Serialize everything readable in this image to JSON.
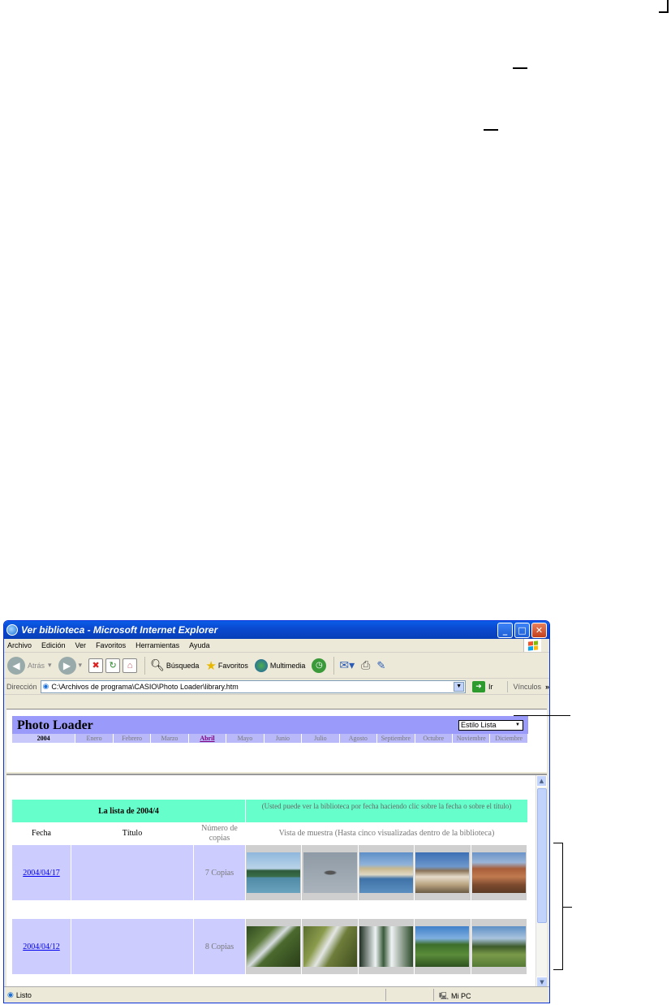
{
  "window": {
    "title": "Ver biblioteca - Microsoft Internet Explorer"
  },
  "menu": [
    "Archivo",
    "Edición",
    "Ver",
    "Favoritos",
    "Herramientas",
    "Ayuda"
  ],
  "toolbar": {
    "back": "Atrás",
    "search": "Búsqueda",
    "favorites": "Favoritos",
    "media": "Multimedia"
  },
  "address": {
    "label": "Dirección",
    "value": "C:\\Archivos de programa\\CASIO\\Photo Loader\\library.htm",
    "go": "Ir",
    "links": "Vínculos"
  },
  "header": {
    "title": "Photo Loader",
    "style_select": "Estilo Lista",
    "year": "2004",
    "months": [
      "Enero",
      "Febrero",
      "Marzo",
      "Abril",
      "Mayo",
      "Junio",
      "Julio",
      "Agosto",
      "Septiembre",
      "Octubre",
      "Noviembre",
      "Diciembre"
    ],
    "active_month": "Abril"
  },
  "list": {
    "heading": "La lista de 2004/4",
    "note": "(Usted puede ver la biblioteca por fecha haciendo clic sobre la fecha o sobre el título)",
    "col_date": "Fecha",
    "col_title": "Título",
    "col_copies": "Número de copias",
    "col_preview": "Vista de muestra (Hasta cinco visualizadas dentro de la biblioteca)",
    "rows": [
      {
        "date": "2004/04/17",
        "title": "",
        "copies": "7 Copias"
      },
      {
        "date": "2004/04/12",
        "title": "",
        "copies": "8 Copias"
      }
    ]
  },
  "status": {
    "text": "Listo",
    "zone": "Mi PC"
  }
}
